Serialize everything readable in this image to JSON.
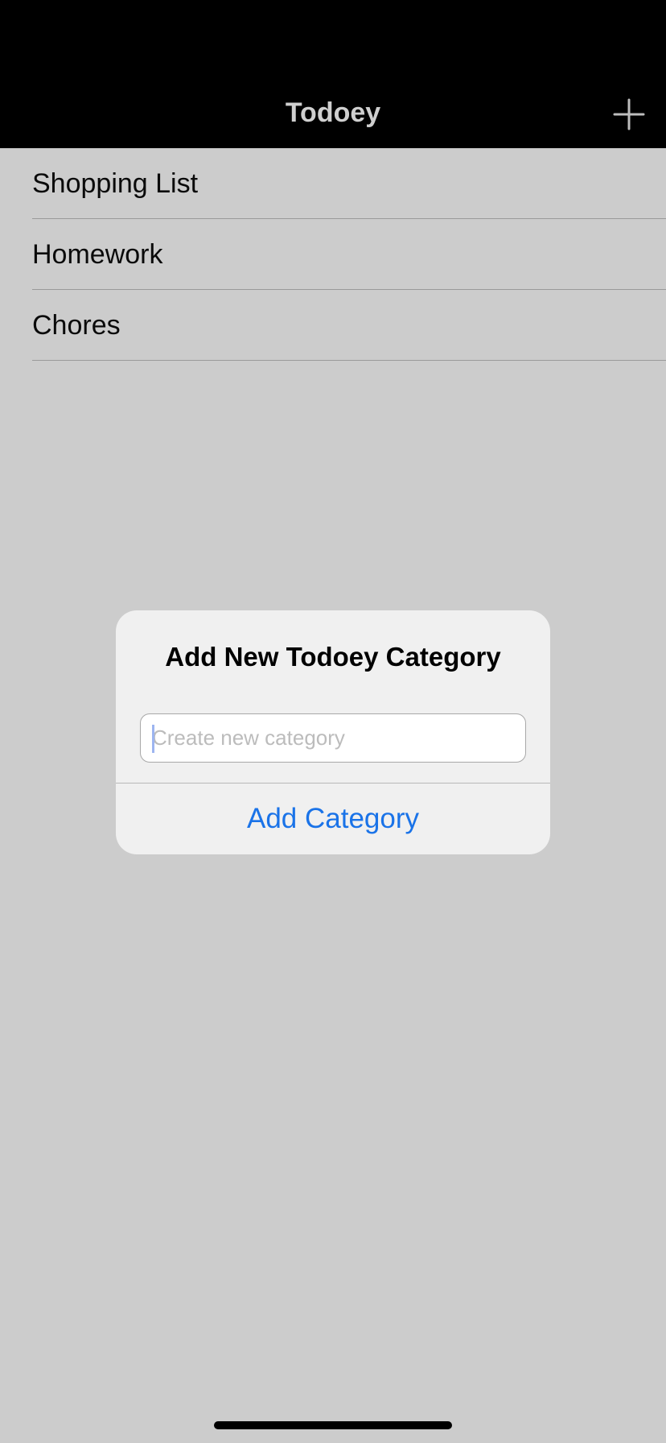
{
  "navbar": {
    "title": "Todoey",
    "add_icon": "plus-icon"
  },
  "categories": [
    {
      "label": "Shopping List"
    },
    {
      "label": "Homework"
    },
    {
      "label": "Chores"
    }
  ],
  "alert": {
    "title": "Add New Todoey Category",
    "input_value": "",
    "input_placeholder": "Create new category",
    "action_label": "Add Category"
  },
  "colors": {
    "navbar_bg": "#000000",
    "list_bg": "#cccccc",
    "accent": "#1a73e8"
  }
}
